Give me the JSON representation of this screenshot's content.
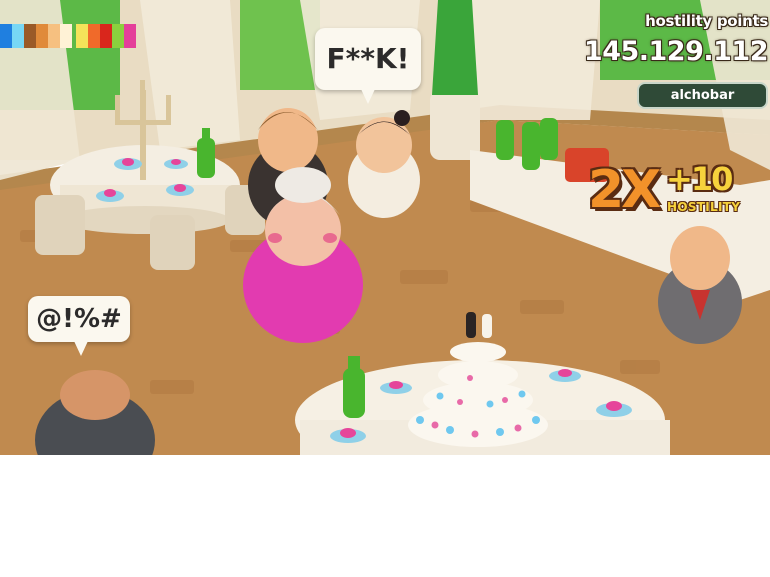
{
  "hud": {
    "label": "hostility points",
    "points": "145.129.112",
    "badge": "alchobar"
  },
  "bubbles": {
    "right": "F**K!",
    "left": "@!%#"
  },
  "combo": {
    "multiplier": "2X",
    "bonus": "+10",
    "word": "HOSTILITY"
  },
  "swatches": {
    "left": [
      "#1f7fe0",
      "#78d7f5",
      "#9a5a28",
      "#e08a3a",
      "#f6c080",
      "#fff2d6"
    ],
    "right": [
      "#f4e35a",
      "#f06a2a",
      "#d9261c",
      "#8ad13e",
      "#e43f9a"
    ]
  },
  "colors": {
    "floor": "#c08a4f",
    "curtain": "#efe6d4",
    "window_green": "#58b84a",
    "pink_dress": "#e23bb0",
    "bottle_green": "#49b52e"
  }
}
